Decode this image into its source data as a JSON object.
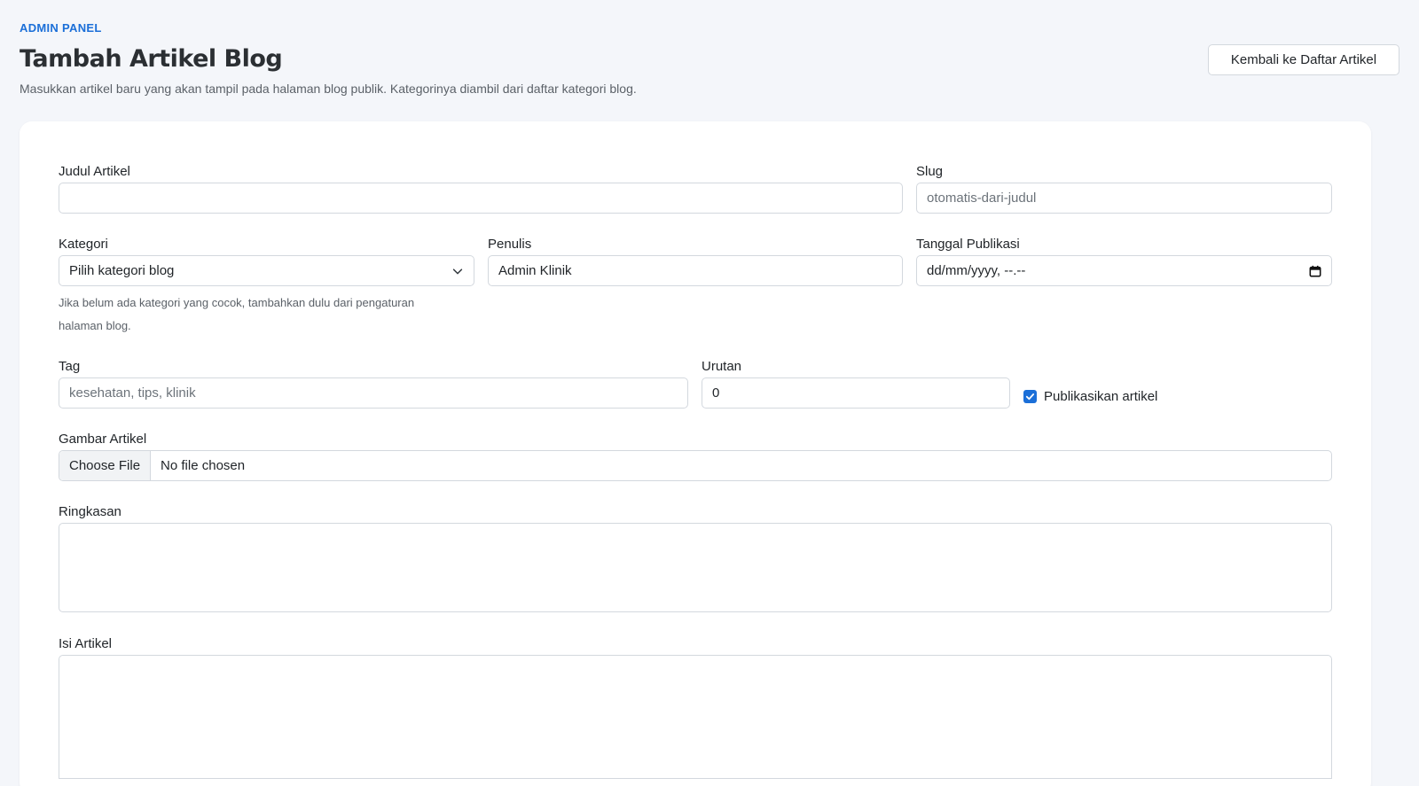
{
  "header": {
    "eyebrow": "ADMIN PANEL",
    "title": "Tambah Artikel Blog",
    "description": "Masukkan artikel baru yang akan tampil pada halaman blog publik. Kategorinya diambil dari daftar kategori blog.",
    "back_label": "Kembali ke Daftar Artikel"
  },
  "form": {
    "title_label": "Judul Artikel",
    "title_value": "",
    "slug_label": "Slug",
    "slug_placeholder": "otomatis-dari-judul",
    "category_label": "Kategori",
    "category_selected": "Pilih kategori blog",
    "category_help": "Jika belum ada kategori yang cocok, tambahkan dulu dari pengaturan halaman blog.",
    "author_label": "Penulis",
    "author_value": "Admin Klinik",
    "date_label": "Tanggal Publikasi",
    "date_placeholder": "dd/mm/yyyy, --.--",
    "tag_label": "Tag",
    "tag_placeholder": "kesehatan, tips, klinik",
    "order_label": "Urutan",
    "order_value": "0",
    "publish_label": "Publikasikan artikel",
    "publish_checked": true,
    "image_label": "Gambar Artikel",
    "file_button": "Choose File",
    "file_status": "No file chosen",
    "summary_label": "Ringkasan",
    "content_label": "Isi Artikel"
  },
  "colors": {
    "accent": "#1b6fd8",
    "background": "#f4f6fa",
    "border": "#d3d8de"
  }
}
